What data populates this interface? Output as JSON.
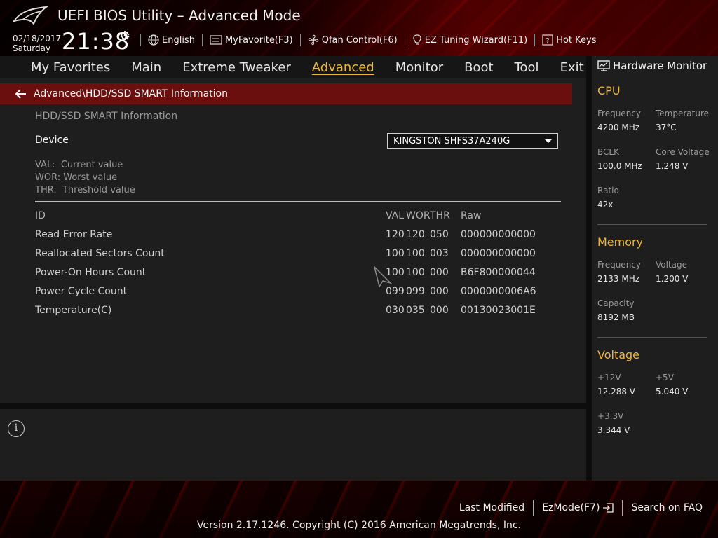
{
  "header": {
    "title": "UEFI BIOS Utility – Advanced Mode",
    "date": "02/18/2017",
    "day": "Saturday",
    "time": "21:38",
    "toolbar": [
      {
        "label": "English",
        "icon": "globe-icon"
      },
      {
        "label": "MyFavorite(F3)",
        "icon": "favorite-list-icon"
      },
      {
        "label": "Qfan Control(F6)",
        "icon": "fan-icon"
      },
      {
        "label": "EZ Tuning Wizard(F11)",
        "icon": "lightbulb-icon"
      },
      {
        "label": "Hot Keys",
        "icon": "question-box-icon"
      }
    ]
  },
  "nav": {
    "tabs": [
      "My Favorites",
      "Main",
      "Extreme Tweaker",
      "Advanced",
      "Monitor",
      "Boot",
      "Tool",
      "Exit"
    ],
    "active": "Advanced"
  },
  "main": {
    "breadcrumb": "Advanced\\HDD/SSD SMART Information",
    "section_title": "HDD/SSD SMART Information",
    "device_label": "Device",
    "device_value": "KINGSTON SHFS37A240G",
    "legend": [
      "VAL:  Current value",
      "WOR: Worst value",
      "THR:  Threshold value"
    ],
    "table": {
      "headers": {
        "id": "ID",
        "val": "VAL",
        "wor": "WOR",
        "thr": "THR",
        "raw": "Raw"
      },
      "rows": [
        {
          "id": "Read Error Rate",
          "val": "120",
          "wor": "120",
          "thr": "050",
          "raw": "000000000000"
        },
        {
          "id": "Reallocated Sectors Count",
          "val": "100",
          "wor": "100",
          "thr": "003",
          "raw": "000000000000"
        },
        {
          "id": "Power-On Hours Count",
          "val": "100",
          "wor": "100",
          "thr": "000",
          "raw": "B6F800000044"
        },
        {
          "id": "Power Cycle Count",
          "val": "099",
          "wor": "099",
          "thr": "000",
          "raw": "0000000006A6"
        },
        {
          "id": "Temperature(C)",
          "val": "030",
          "wor": "035",
          "thr": "000",
          "raw": "00130023001E"
        }
      ]
    }
  },
  "hw": {
    "title": "Hardware Monitor",
    "cpu": {
      "title": "CPU",
      "frequency_label": "Frequency",
      "frequency": "4200 MHz",
      "temperature_label": "Temperature",
      "temperature": "37°C",
      "bclk_label": "BCLK",
      "bclk": "100.0 MHz",
      "core_voltage_label": "Core Voltage",
      "core_voltage": "1.248 V",
      "ratio_label": "Ratio",
      "ratio": "42x"
    },
    "memory": {
      "title": "Memory",
      "frequency_label": "Frequency",
      "frequency": "2133 MHz",
      "voltage_label": "Voltage",
      "voltage": "1.200 V",
      "capacity_label": "Capacity",
      "capacity": "8192 MB"
    },
    "voltage": {
      "title": "Voltage",
      "v12_label": "+12V",
      "v12": "12.288 V",
      "v5_label": "+5V",
      "v5": "5.040 V",
      "v33_label": "+3.3V",
      "v33": "3.344 V"
    }
  },
  "footer": {
    "last_modified": "Last Modified",
    "ezmode": "EzMode(F7)",
    "search_faq": "Search on FAQ",
    "copyright": "Version 2.17.1246. Copyright (C) 2016 American Megatrends, Inc."
  },
  "colors": {
    "accent": "#f0b732",
    "breadcrumb_bg": "#6b0e0e",
    "panel_bg": "#1e1e1e"
  }
}
